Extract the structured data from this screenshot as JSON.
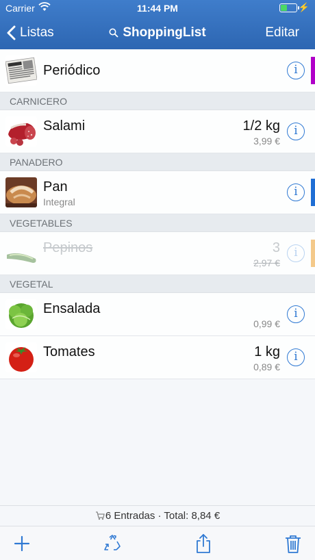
{
  "status": {
    "carrier": "Carrier",
    "time": "11:44 PM",
    "battery_level": 0.4
  },
  "nav": {
    "back_label": "Listas",
    "title": "ShoppingList",
    "edit_label": "Editar"
  },
  "featured": {
    "name": "Periódico",
    "info_glyph": "i",
    "color": "#b000c8"
  },
  "sections": [
    {
      "header": "CARNICERO",
      "items": [
        {
          "name": "Salami",
          "qty": "1/2 kg",
          "price": "3,99 €",
          "color": null,
          "done": false
        }
      ]
    },
    {
      "header": "PANADERO",
      "items": [
        {
          "name": "Pan",
          "sub": "Integral",
          "color": "#1f6ed4",
          "done": false
        }
      ]
    },
    {
      "header": "VEGETABLES",
      "items": [
        {
          "name": "Pepinos",
          "qty": "3",
          "price": "2,97 €",
          "color": "#f4c98a",
          "done": true
        }
      ]
    },
    {
      "header": "VEGETAL",
      "items": [
        {
          "name": "Ensalada",
          "price": "0,99 €",
          "color": null,
          "done": false
        },
        {
          "name": "Tomates",
          "qty": "1 kg",
          "price": "0,89 €",
          "color": null,
          "done": false
        }
      ]
    }
  ],
  "summary": {
    "text": "6 Entradas · Total: 8,84 €"
  },
  "toolbar": {
    "icons": [
      "plus-icon",
      "recycle-icon",
      "share-icon",
      "trash-icon"
    ]
  },
  "colors": {
    "accent": "#2f79d3",
    "nav_bg": "#2d66b2"
  }
}
